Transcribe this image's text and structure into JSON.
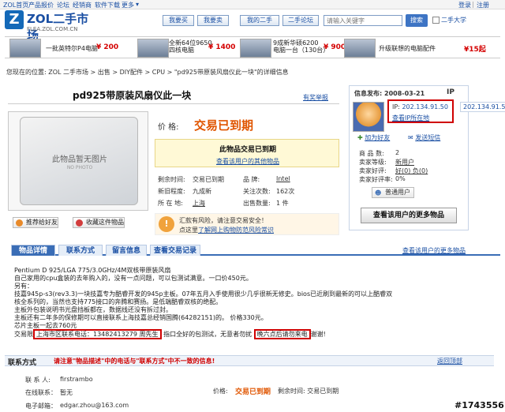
{
  "topnav": {
    "items": [
      "ZOL首页",
      "产品报价",
      "论坛",
      "经销商",
      "软件下载",
      "更多"
    ],
    "login": "登录",
    "register": "注册"
  },
  "header": {
    "logo_letter": "Z",
    "logo_text": "ZOL二手市场",
    "logo_url": "FLEA.ZOL.COM.CN",
    "buttons": [
      "我要买",
      "我要卖",
      "我的二手",
      "二手论坛"
    ],
    "search_placeholder": "请输入关键字",
    "search_button": "搜索",
    "checkbox_label": "二手大学"
  },
  "ads": [
    {
      "text": "一批英特尔P4电脑",
      "price": "¥ 200"
    },
    {
      "text": "全新64位9650\n四核电脑",
      "price": "¥ 1400"
    },
    {
      "text": "9成新华硕6200\n电脑一台（130台）",
      "price": "¥ 900"
    },
    {
      "text": "升级联想的电脑配件",
      "price": "¥15起"
    }
  ],
  "breadcrumb": "您现在的位置: ZOL 二手市场 > 出售 > DIY配件 > CPU > \"pd925带原装风扇仪此一块\"的详细信息",
  "item": {
    "title": "pd925带原装风扇仪此一块",
    "report_link": "有奖举报",
    "photo_text": "此物品暂无图片",
    "photo_sub": "NO PHOTO",
    "price_label": "价    格:",
    "price_value": "交易已到期",
    "expired_title": "此物品交易已到期",
    "expired_link": "查看该用户的其他物品",
    "rows": [
      {
        "label": "剩余时间:",
        "value": "交易已到期",
        "label2": "品    牌:",
        "value2": "Intel",
        "value2_link": true
      },
      {
        "label": "新旧程度:",
        "value": "九成新",
        "label2": "关注次数:",
        "value2": "162次",
        "value2_link": false
      },
      {
        "label": "所 在 地:",
        "value": "上海",
        "value_link": true,
        "label2": "出售数量:",
        "value2": "1 件",
        "value2_link": false
      }
    ],
    "notice_1": "汇款有风险，请注意交易安全！",
    "notice_2_prefix": "点这里",
    "notice_2_link": "了解网上购物防范风险常识",
    "btn_recommend": "推荐给好友",
    "btn_favorite": "收藏这件物品"
  },
  "seller": {
    "header_prefix": "信息发布:",
    "date": "2008-03-21",
    "ip_tab": "IP",
    "ip_label": "IP:",
    "ip_value": "202.134.91.50",
    "ip_link": "查看IP所在地",
    "ip_float": "202.134.91.50",
    "add_friend": "加为好友",
    "send_msg": "发送短信",
    "stats": [
      {
        "label": "商 品 数:",
        "value": "2"
      },
      {
        "label": "卖家等级:",
        "value": "新用户"
      },
      {
        "label": "卖家好评:",
        "value": "好(0)  负(0)"
      },
      {
        "label": "卖家好评率:",
        "value": "0%"
      }
    ],
    "common_user": "普通用户",
    "more_items": "查看该用户的更多物品"
  },
  "tabs": {
    "items": [
      "物品详情",
      "联系方式",
      "留言信息",
      "查看交易记录"
    ],
    "right_link": "查看该用户的更多物品"
  },
  "desc": {
    "lines": [
      "Pentium D 925/LGA 775/3.0GHz/4M双核带原装风扇",
      "自己家用的cpu盒装的去年购入的，没有一点问题，可以包测试满意。一口价450元。",
      "另有：",
      "技嘉945p-s3(rev3.3)一块技嘉专为酷睿开发的945p主板。07年五月入手使用很少几乎很新无修史。bios已近刷到最新的可以上酷睿双",
      "核全系列的，当然也支持775接口的奔腾和赛扬。是低端酷睿双核的绝配。",
      "主板外包装说明书光盘挡板都在，数据线还没有拆过封。",
      "主板还有二年多的保修期可以直接联系上海技嘉总经销国腾(64282151)的。  价格330元。",
      "芯片主板一起去760元"
    ],
    "last_prefix": "交易限",
    "last_box1": "上海市区联系电话：13482413279 周先生",
    "last_mid": " 指口全好的包测试，无意者勿扰",
    "last_box2": "晚六点后请勿来电",
    "last_suffix": "谢谢!"
  },
  "contact": {
    "title": "联系方式",
    "warn": "请注意\"物品描述\"中的电话与\"联系方式\"中不一致的信息!",
    "back_top": "返回顶部",
    "person_label": "联 系 人:",
    "person": "firstrambo",
    "status_label": "在线联系：",
    "status": "暂无",
    "email_label": "电子邮箱：",
    "email": "edgar.zhou@163.com",
    "price_label": "价格:",
    "price_value": "交易已到期",
    "remaining": "剩余时间: 交易已到期"
  },
  "watermark": "#1743556",
  "colors": {
    "brand_blue": "#1a4fa3",
    "accent_orange": "#e05500",
    "alert_red": "#d00000"
  }
}
